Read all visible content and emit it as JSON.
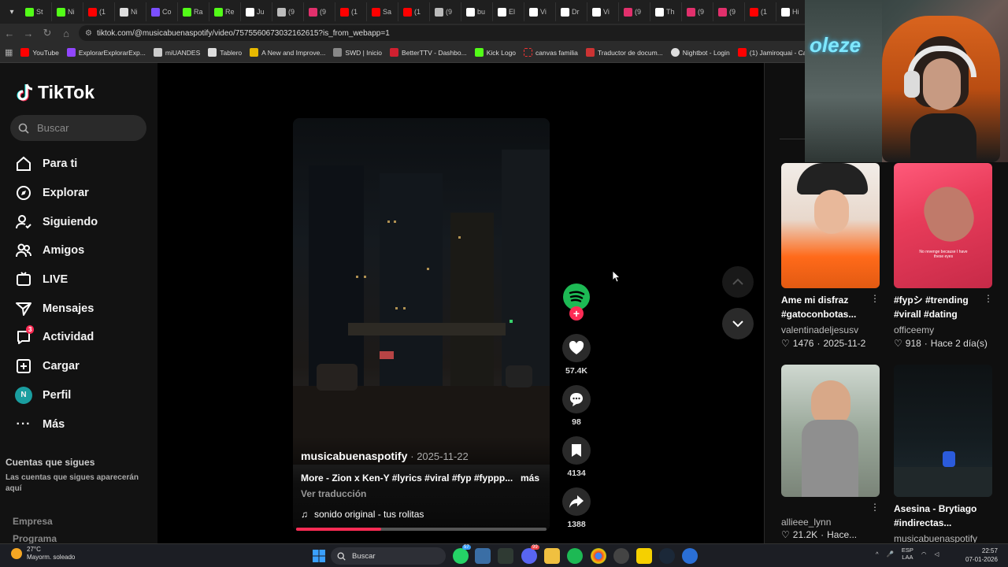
{
  "browser": {
    "tabs": [
      "St",
      "Ni",
      "(1",
      "Ni",
      "Co",
      "Ra",
      "Re",
      "Ju",
      "(9",
      "(9",
      "(1",
      "Sa",
      "(1",
      "(9",
      "bu",
      "El",
      "Vi",
      "Dr",
      "Vi",
      "(9",
      "Th",
      "(9",
      "(9",
      "(1",
      "Hi"
    ],
    "url": "tiktok.com/@musicabuenaspotify/video/7575560673032162615?is_from_webapp=1",
    "bookmarks": [
      "YouTube",
      "ExplorarExplorarExp...",
      "miUANDES",
      "Tablero",
      "A New and Improve...",
      "SWD | Inicio",
      "BetterTTV - Dashbo...",
      "Kick Logo",
      "canvas familia",
      "Traductor de docum...",
      "Nightbot - Login",
      "(1) Jamiroquai - Can..."
    ]
  },
  "tiktok": {
    "logo": "TikTok",
    "search_placeholder": "Buscar",
    "nav": [
      {
        "label": "Para ti",
        "icon": "home-icon"
      },
      {
        "label": "Explorar",
        "icon": "compass-icon"
      },
      {
        "label": "Siguiendo",
        "icon": "following-icon"
      },
      {
        "label": "Amigos",
        "icon": "friends-icon"
      },
      {
        "label": "LIVE",
        "icon": "live-icon"
      },
      {
        "label": "Mensajes",
        "icon": "send-icon"
      },
      {
        "label": "Actividad",
        "icon": "inbox-icon",
        "badge": "3"
      },
      {
        "label": "Cargar",
        "icon": "upload-icon"
      },
      {
        "label": "Perfil",
        "icon": "avatar",
        "initial": "N"
      },
      {
        "label": "Más",
        "icon": "more-icon"
      }
    ],
    "following_title": "Cuentas que sigues",
    "following_empty": "Las cuentas que sigues aparecerán aquí",
    "footer": [
      "Empresa",
      "Programa"
    ]
  },
  "video": {
    "author": "musicabuenaspotify",
    "date": "· 2025-11-22",
    "description": "More - Zion x Ken-Y #lyrics #viral #fyp #fyppp...",
    "more": "más",
    "translate": "Ver traducción",
    "sound": "sonido original - tus rolitas",
    "progress": 0.34,
    "likes": "57.4K",
    "comments": "98",
    "saves": "4134",
    "shares": "1388"
  },
  "suggested": [
    {
      "title": "Ame mi disfraz #gatoconbotas...",
      "author": "valentinadeljesusv",
      "likes": "1476",
      "date": "2025-11-2"
    },
    {
      "title": "#fypシ #trending #virall #dating",
      "author": "officeemy",
      "likes": "918",
      "date": "Hace 2 día(s)"
    },
    {
      "title": "",
      "author": "allieee_lynn",
      "likes": "21.2K",
      "date": "Hace..."
    },
    {
      "title": "Asesina - Brytiago #indirectas...",
      "author": "musicabuenaspotify",
      "likes": "",
      "date": ""
    }
  ],
  "thumb_caption": "No revenge because I have these eyes",
  "cam_logo": "oleze",
  "taskbar": {
    "temp": "27°C",
    "weather": "Mayorm. soleado",
    "search": "Buscar",
    "lang1": "ESP",
    "lang2": "LAA",
    "time": "22:57",
    "date": "07-01-2026",
    "badge_whatsapp": "57",
    "badge_discord": "99"
  },
  "colors": {
    "accent": "#fe2c55",
    "spotify": "#1db954"
  }
}
